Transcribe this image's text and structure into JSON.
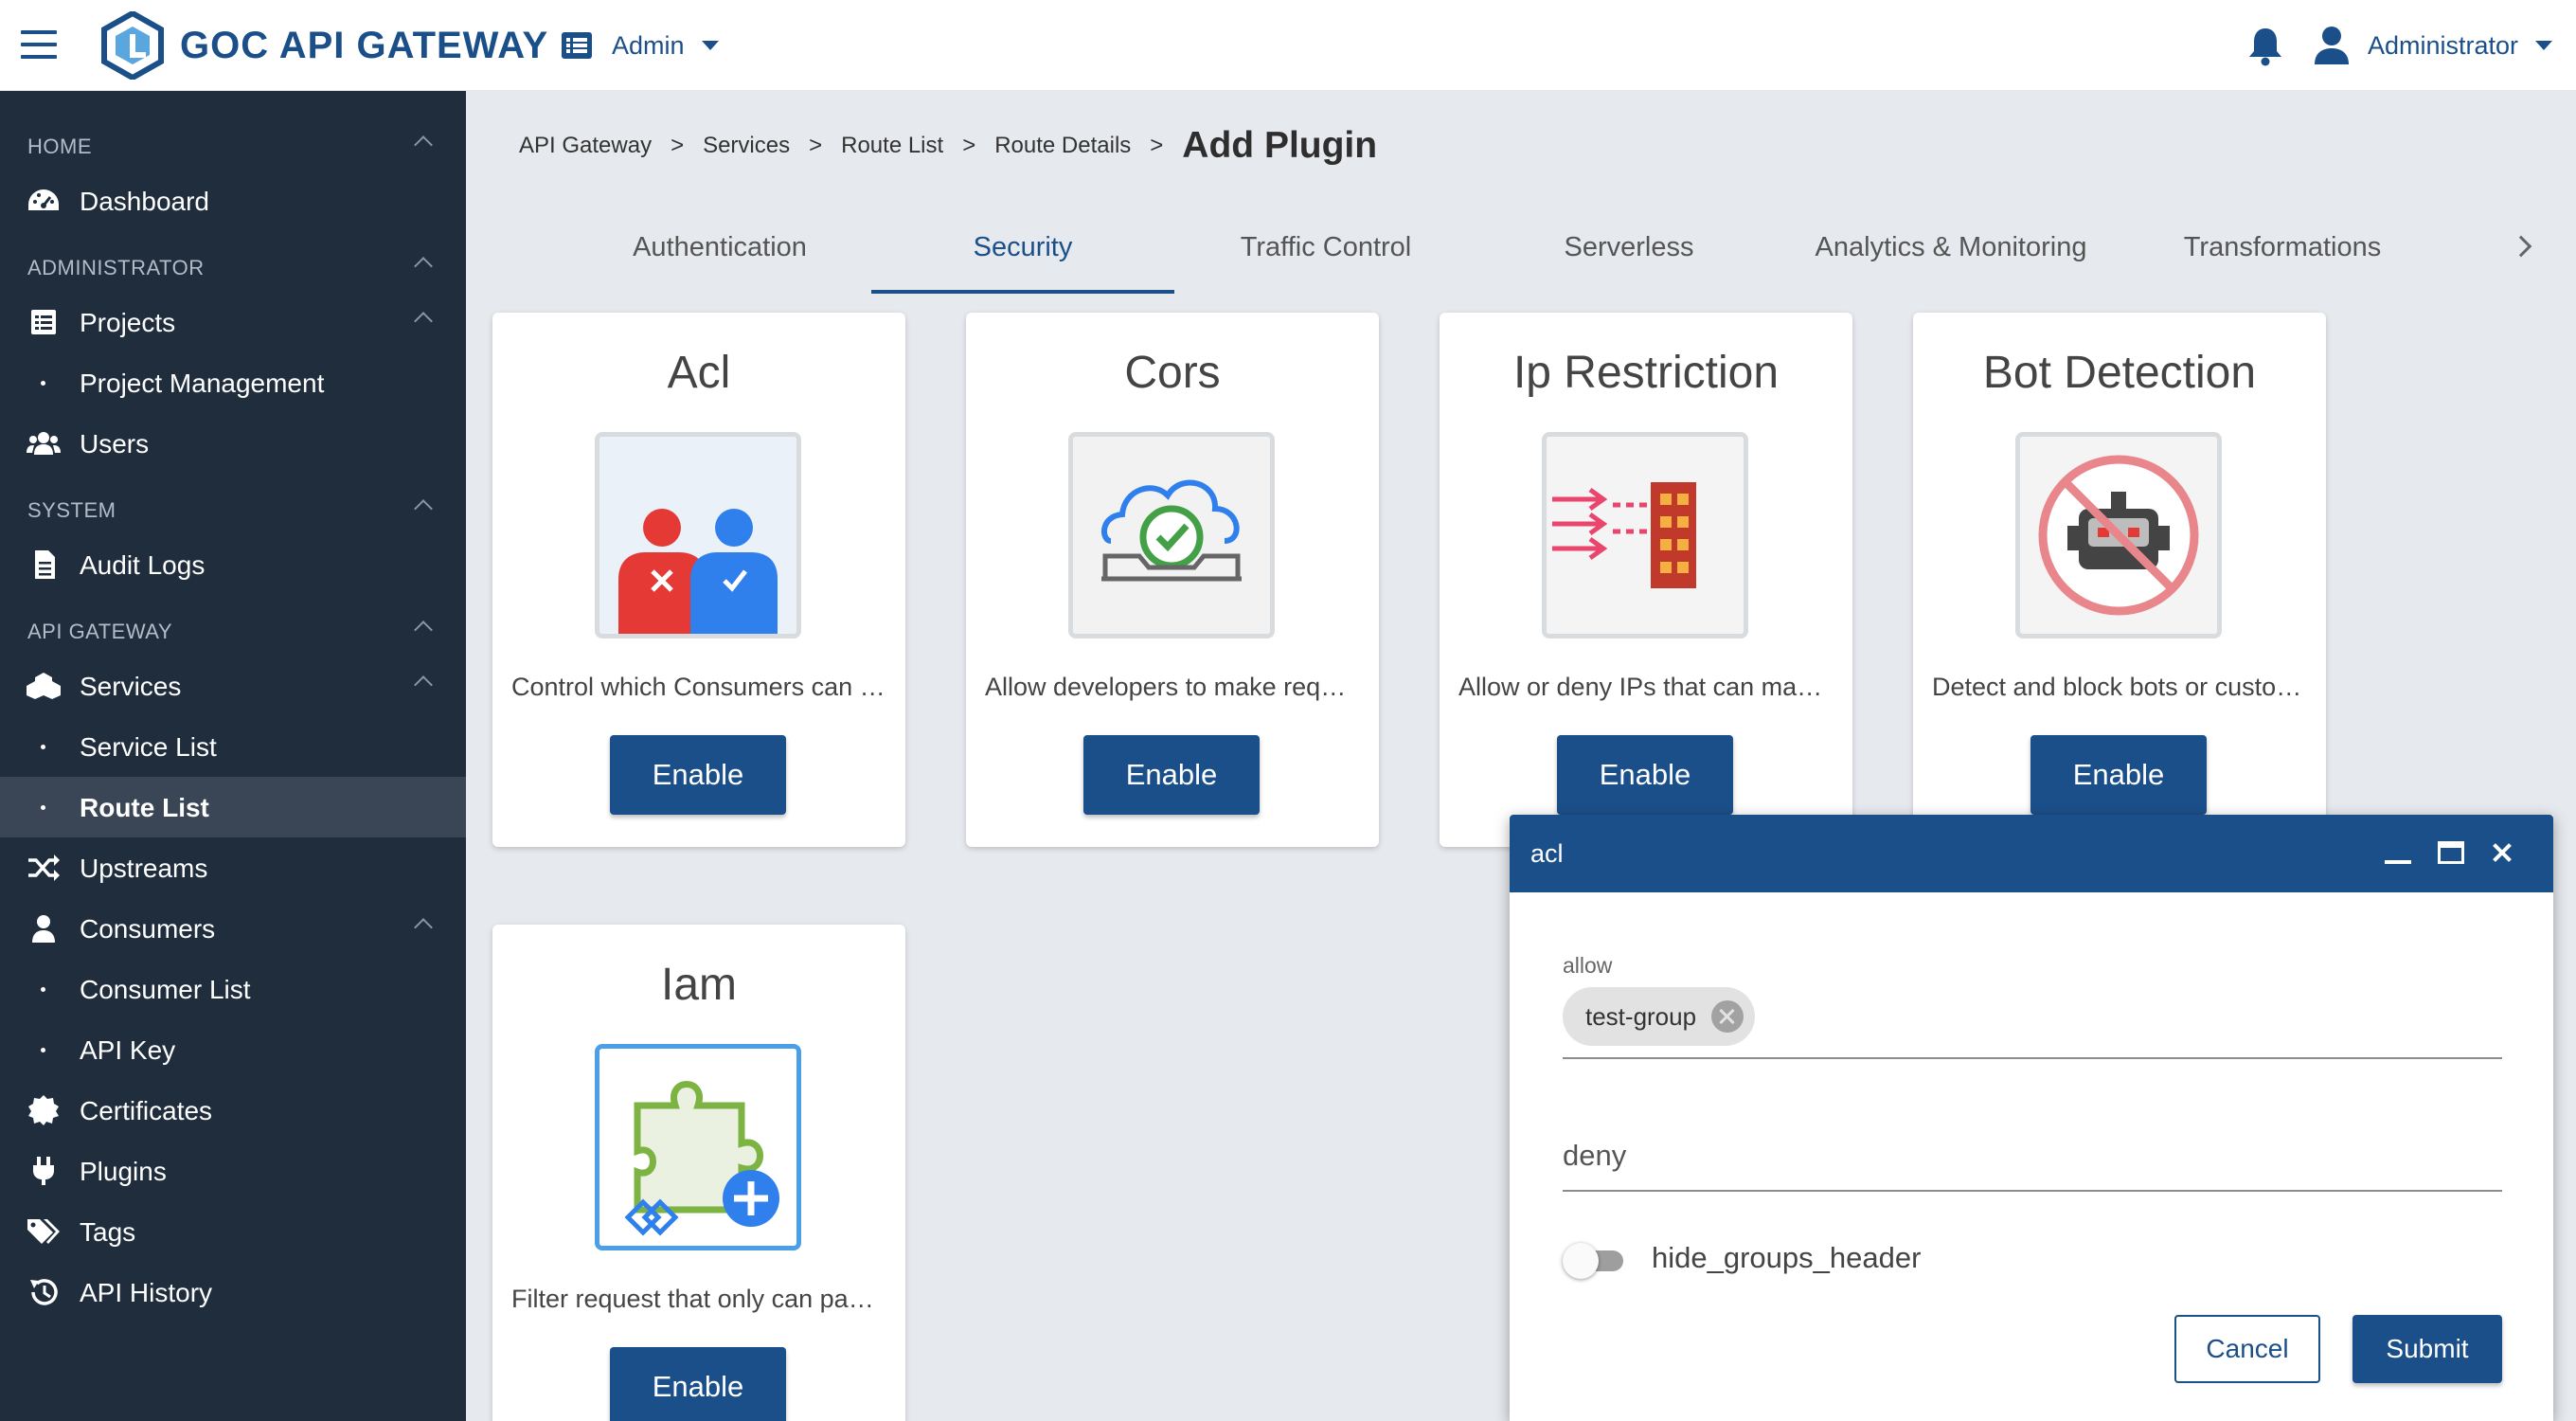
{
  "header": {
    "app_title": "GOC API GATEWAY",
    "menu_icon": "hamburger-menu-icon",
    "logo_icon": "gateway-logo-icon",
    "context_label": "Admin",
    "context_icon": "list-icon",
    "notification_icon": "bell-icon",
    "user_label": "Administrator",
    "user_icon": "user-icon",
    "brand_color": "#1b4f8a"
  },
  "sidebar": {
    "sections": {
      "home": "HOME",
      "administrator": "ADMINISTRATOR",
      "system": "SYSTEM",
      "api_gateway": "API GATEWAY"
    },
    "items": {
      "dashboard": "Dashboard",
      "projects": "Projects",
      "project_management": "Project Management",
      "users": "Users",
      "audit_logs": "Audit Logs",
      "services": "Services",
      "service_list": "Service List",
      "route_list": "Route List",
      "upstreams": "Upstreams",
      "consumers": "Consumers",
      "consumer_list": "Consumer List",
      "api_key": "API Key",
      "certificates": "Certificates",
      "plugins": "Plugins",
      "tags": "Tags",
      "api_history": "API History"
    },
    "active_item": "Route List",
    "background_color": "#1f2d3d"
  },
  "breadcrumb": {
    "items": [
      "API Gateway",
      "Services",
      "Route List",
      "Route Details"
    ],
    "separator": ">",
    "current": "Add Plugin"
  },
  "tabs": {
    "items": [
      "Authentication",
      "Security",
      "Traffic Control",
      "Serverless",
      "Analytics & Monitoring",
      "Transformations"
    ],
    "active": "Security",
    "more_icon": "chevron-right-icon"
  },
  "plugins": [
    {
      "title": "Acl",
      "description": "Control which Consumers can access Services",
      "button": "Enable",
      "icon": "acl-users-icon"
    },
    {
      "title": "Cors",
      "description": "Allow developers to make requests from the browser",
      "button": "Enable",
      "icon": "cors-cloud-check-icon"
    },
    {
      "title": "Ip Restriction",
      "description": "Allow or deny IPs that can make requests",
      "button": "Enable",
      "icon": "firewall-icon"
    },
    {
      "title": "Bot Detection",
      "description": "Detect and block bots or custom clients",
      "button": "Enable",
      "icon": "no-bot-icon"
    },
    {
      "title": "Iam",
      "description": "Filter request that only can pass IAM",
      "button": "Enable",
      "icon": "puzzle-plus-icon"
    }
  ],
  "dialog": {
    "title": "acl",
    "allow_label": "allow",
    "allow_values": [
      "test-group"
    ],
    "deny_placeholder": "deny",
    "toggle_label": "hide_groups_header",
    "toggle_on": false,
    "cancel_label": "Cancel",
    "submit_label": "Submit"
  }
}
